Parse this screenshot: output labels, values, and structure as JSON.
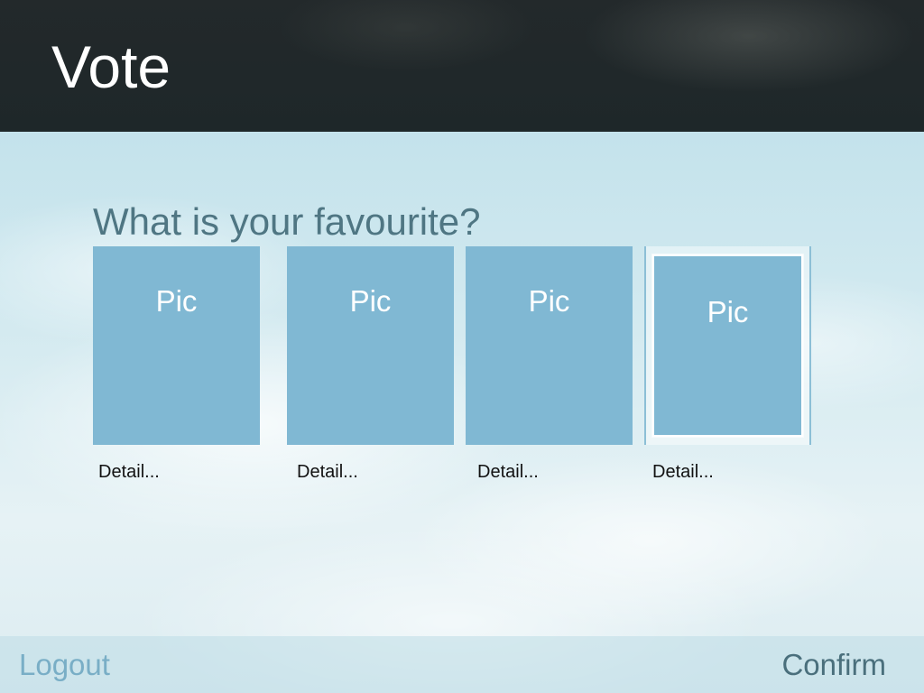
{
  "header": {
    "title": "Vote"
  },
  "main": {
    "question": "What is your favourite?",
    "options": [
      {
        "pic_label": "Pic",
        "detail_label": "Detail...",
        "selected": false
      },
      {
        "pic_label": "Pic",
        "detail_label": "Detail...",
        "selected": false
      },
      {
        "pic_label": "Pic",
        "detail_label": "Detail...",
        "selected": false
      },
      {
        "pic_label": "Pic",
        "detail_label": "Detail...",
        "selected": true
      }
    ]
  },
  "footer": {
    "logout_label": "Logout",
    "confirm_label": "Confirm"
  },
  "colors": {
    "header_bg": "#1e2729",
    "card_fill": "#80b8d3",
    "question_text": "#4f7683",
    "logout_text": "#79aec6",
    "confirm_text": "#4a6f7c"
  }
}
